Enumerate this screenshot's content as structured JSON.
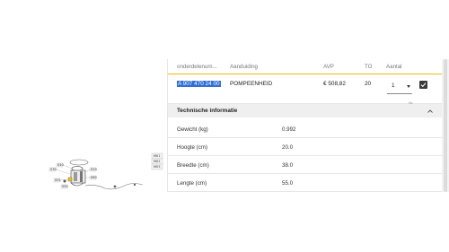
{
  "table": {
    "headers": {
      "part": "onderdelenum...",
      "name": "Aanduiding",
      "price": "AVP",
      "tg": "TG",
      "qty": "Aantal"
    },
    "row": {
      "part": "A 907 470 24 00",
      "name": "POMPEENHEID",
      "price": "€ 508,82",
      "tg": "20",
      "qty": "1",
      "checked": true
    }
  },
  "tech": {
    "title": "Technische informatie",
    "rows": [
      {
        "label": "Gewicht (kg)",
        "value": "0.992"
      },
      {
        "label": "Hoogte (cm)",
        "value": "20.0"
      },
      {
        "label": "Breedte (cm)",
        "value": "38.0"
      },
      {
        "label": "Lengte (cm)",
        "value": "55.0"
      }
    ]
  },
  "diagram_labels": [
    "M01",
    "M02",
    "M03",
    "030",
    "040",
    "001",
    "050",
    "020",
    "060"
  ],
  "colors": {
    "accent": "#f2b705",
    "selection": "#2f6fd6"
  }
}
